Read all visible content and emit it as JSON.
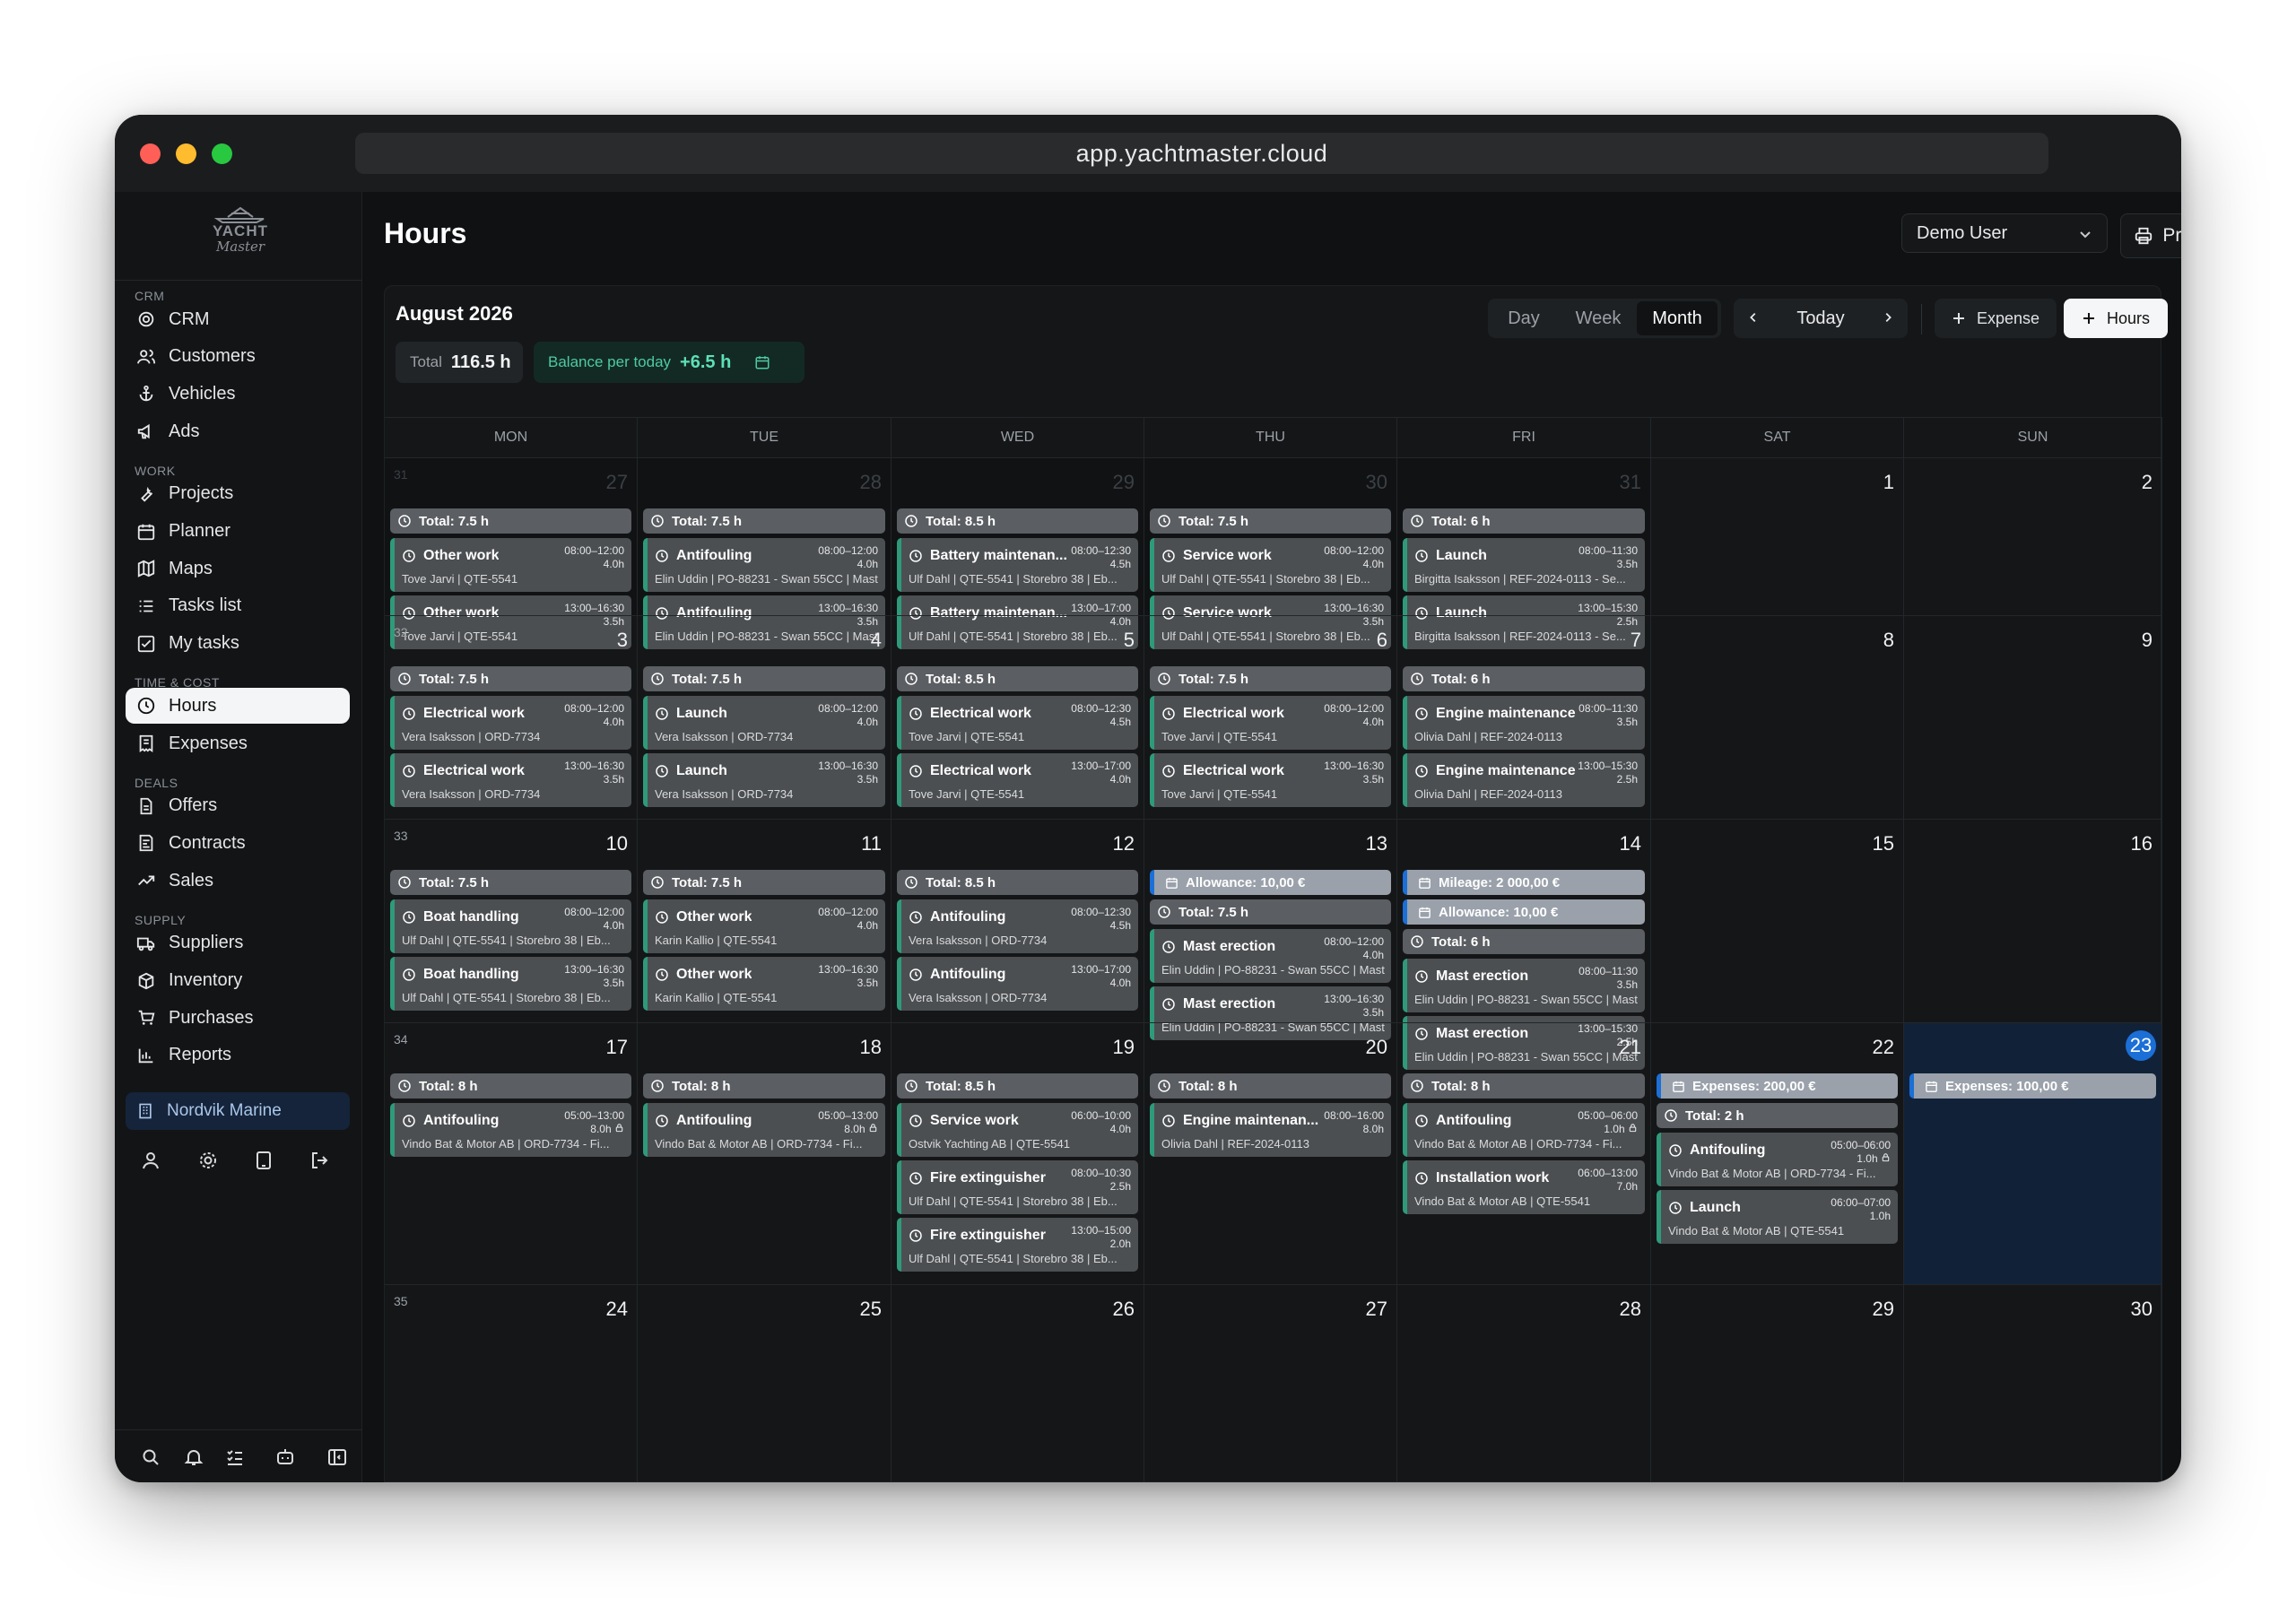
{
  "browser": {
    "url": "app.yachtmaster.cloud"
  },
  "logo": {
    "line1": "YACHT",
    "line2": "Master"
  },
  "sidebar": {
    "sections": [
      {
        "label": "CRM",
        "items": [
          {
            "label": "CRM",
            "icon": "target-icon"
          },
          {
            "label": "Customers",
            "icon": "users-icon"
          },
          {
            "label": "Vehicles",
            "icon": "anchor-icon"
          },
          {
            "label": "Ads",
            "icon": "megaphone-icon"
          }
        ]
      },
      {
        "label": "WORK",
        "items": [
          {
            "label": "Projects",
            "icon": "wrench-icon"
          },
          {
            "label": "Planner",
            "icon": "calendar-icon"
          },
          {
            "label": "Maps",
            "icon": "map-icon"
          },
          {
            "label": "Tasks list",
            "icon": "list-icon"
          },
          {
            "label": "My tasks",
            "icon": "checkbox-icon"
          }
        ]
      },
      {
        "label": "TIME & COST",
        "items": [
          {
            "label": "Hours",
            "icon": "clock-icon",
            "active": true
          },
          {
            "label": "Expenses",
            "icon": "receipt-icon"
          }
        ]
      },
      {
        "label": "DEALS",
        "items": [
          {
            "label": "Offers",
            "icon": "document-icon"
          },
          {
            "label": "Contracts",
            "icon": "contract-icon"
          },
          {
            "label": "Sales",
            "icon": "trend-icon"
          }
        ]
      },
      {
        "label": "SUPPLY",
        "items": [
          {
            "label": "Suppliers",
            "icon": "truck-icon"
          },
          {
            "label": "Inventory",
            "icon": "box-icon"
          },
          {
            "label": "Purchases",
            "icon": "cart-icon"
          },
          {
            "label": "Reports",
            "icon": "chart-icon"
          }
        ]
      }
    ],
    "company": "Nordvik Marine"
  },
  "header": {
    "title": "Hours",
    "user": "Demo User",
    "print_label": "Print"
  },
  "calendar": {
    "month_label": "August 2026",
    "total_label": "Total",
    "total_value": "116.5 h",
    "balance_label": "Balance per today",
    "balance_value": "+6.5 h",
    "views": [
      "Day",
      "Week",
      "Month"
    ],
    "active_view": "Month",
    "today_label": "Today",
    "expense_label": "Expense",
    "hours_label": "Hours",
    "day_names": [
      "MON",
      "TUE",
      "WED",
      "THU",
      "FRI",
      "SAT",
      "SUN"
    ],
    "weeks": [
      {
        "week": "31",
        "days": [
          {
            "day": "27",
            "outside": true,
            "events": [
              {
                "kind": "total",
                "text": "Total: 7.5 h"
              },
              {
                "kind": "entry",
                "title": "Other work",
                "time": "08:00–12:00",
                "dur": "4.0h",
                "sub": "Tove Jarvi | QTE-5541"
              },
              {
                "kind": "entry",
                "title": "Other work",
                "time": "13:00–16:30",
                "dur": "3.5h",
                "sub": "Tove Jarvi | QTE-5541"
              }
            ]
          },
          {
            "day": "28",
            "outside": true,
            "events": [
              {
                "kind": "total",
                "text": "Total: 7.5 h"
              },
              {
                "kind": "entry",
                "title": "Antifouling",
                "time": "08:00–12:00",
                "dur": "4.0h",
                "sub": "Elin Uddin | PO-88231 - Swan 55CC | Mast"
              },
              {
                "kind": "entry",
                "title": "Antifouling",
                "time": "13:00–16:30",
                "dur": "3.5h",
                "sub": "Elin Uddin | PO-88231 - Swan 55CC | Mast"
              }
            ]
          },
          {
            "day": "29",
            "outside": true,
            "events": [
              {
                "kind": "total",
                "text": "Total: 8.5 h"
              },
              {
                "kind": "entry",
                "title": "Battery maintenan...",
                "time": "08:00–12:30",
                "dur": "4.5h",
                "sub": "Ulf Dahl | QTE-5541 | Storebro 38 | Eb..."
              },
              {
                "kind": "entry",
                "title": "Battery maintenan...",
                "time": "13:00–17:00",
                "dur": "4.0h",
                "sub": "Ulf Dahl | QTE-5541 | Storebro 38 | Eb..."
              }
            ]
          },
          {
            "day": "30",
            "outside": true,
            "events": [
              {
                "kind": "total",
                "text": "Total: 7.5 h"
              },
              {
                "kind": "entry",
                "title": "Service work",
                "time": "08:00–12:00",
                "dur": "4.0h",
                "sub": "Ulf Dahl | QTE-5541 | Storebro 38 | Eb..."
              },
              {
                "kind": "entry",
                "title": "Service work",
                "time": "13:00–16:30",
                "dur": "3.5h",
                "sub": "Ulf Dahl | QTE-5541 | Storebro 38 | Eb..."
              }
            ]
          },
          {
            "day": "31",
            "outside": true,
            "events": [
              {
                "kind": "total",
                "text": "Total: 6 h"
              },
              {
                "kind": "entry",
                "title": "Launch",
                "time": "08:00–11:30",
                "dur": "3.5h",
                "sub": "Birgitta Isaksson | REF-2024-0113 - Se..."
              },
              {
                "kind": "entry",
                "title": "Launch",
                "time": "13:00–15:30",
                "dur": "2.5h",
                "sub": "Birgitta Isaksson | REF-2024-0113 - Se..."
              }
            ]
          },
          {
            "day": "1",
            "events": []
          },
          {
            "day": "2",
            "events": []
          }
        ]
      },
      {
        "week": "32",
        "days": [
          {
            "day": "3",
            "events": [
              {
                "kind": "total",
                "text": "Total: 7.5 h"
              },
              {
                "kind": "entry",
                "title": "Electrical work",
                "time": "08:00–12:00",
                "dur": "4.0h",
                "sub": "Vera Isaksson | ORD-7734"
              },
              {
                "kind": "entry",
                "title": "Electrical work",
                "time": "13:00–16:30",
                "dur": "3.5h",
                "sub": "Vera Isaksson | ORD-7734"
              }
            ]
          },
          {
            "day": "4",
            "events": [
              {
                "kind": "total",
                "text": "Total: 7.5 h"
              },
              {
                "kind": "entry",
                "title": "Launch",
                "time": "08:00–12:00",
                "dur": "4.0h",
                "sub": "Vera Isaksson | ORD-7734"
              },
              {
                "kind": "entry",
                "title": "Launch",
                "time": "13:00–16:30",
                "dur": "3.5h",
                "sub": "Vera Isaksson | ORD-7734"
              }
            ]
          },
          {
            "day": "5",
            "events": [
              {
                "kind": "total",
                "text": "Total: 8.5 h"
              },
              {
                "kind": "entry",
                "title": "Electrical work",
                "time": "08:00–12:30",
                "dur": "4.5h",
                "sub": "Tove Jarvi | QTE-5541"
              },
              {
                "kind": "entry",
                "title": "Electrical work",
                "time": "13:00–17:00",
                "dur": "4.0h",
                "sub": "Tove Jarvi | QTE-5541"
              }
            ]
          },
          {
            "day": "6",
            "events": [
              {
                "kind": "total",
                "text": "Total: 7.5 h"
              },
              {
                "kind": "entry",
                "title": "Electrical work",
                "time": "08:00–12:00",
                "dur": "4.0h",
                "sub": "Tove Jarvi | QTE-5541"
              },
              {
                "kind": "entry",
                "title": "Electrical work",
                "time": "13:00–16:30",
                "dur": "3.5h",
                "sub": "Tove Jarvi | QTE-5541"
              }
            ]
          },
          {
            "day": "7",
            "events": [
              {
                "kind": "total",
                "text": "Total: 6 h"
              },
              {
                "kind": "entry",
                "title": "Engine maintenance",
                "time": "08:00–11:30",
                "dur": "3.5h",
                "sub": "Olivia Dahl | REF-2024-0113"
              },
              {
                "kind": "entry",
                "title": "Engine maintenance",
                "time": "13:00–15:30",
                "dur": "2.5h",
                "sub": "Olivia Dahl | REF-2024-0113"
              }
            ]
          },
          {
            "day": "8",
            "events": []
          },
          {
            "day": "9",
            "events": []
          }
        ]
      },
      {
        "week": "33",
        "days": [
          {
            "day": "10",
            "events": [
              {
                "kind": "total",
                "text": "Total: 7.5 h"
              },
              {
                "kind": "entry",
                "title": "Boat handling",
                "time": "08:00–12:00",
                "dur": "4.0h",
                "sub": "Ulf Dahl | QTE-5541 | Storebro 38 | Eb..."
              },
              {
                "kind": "entry",
                "title": "Boat handling",
                "time": "13:00–16:30",
                "dur": "3.5h",
                "sub": "Ulf Dahl | QTE-5541 | Storebro 38 | Eb..."
              }
            ]
          },
          {
            "day": "11",
            "events": [
              {
                "kind": "total",
                "text": "Total: 7.5 h"
              },
              {
                "kind": "entry",
                "title": "Other work",
                "time": "08:00–12:00",
                "dur": "4.0h",
                "sub": "Karin Kallio | QTE-5541"
              },
              {
                "kind": "entry",
                "title": "Other work",
                "time": "13:00–16:30",
                "dur": "3.5h",
                "sub": "Karin Kallio | QTE-5541"
              }
            ]
          },
          {
            "day": "12",
            "events": [
              {
                "kind": "total",
                "text": "Total: 8.5 h"
              },
              {
                "kind": "entry",
                "title": "Antifouling",
                "time": "08:00–12:30",
                "dur": "4.5h",
                "sub": "Vera Isaksson | ORD-7734"
              },
              {
                "kind": "entry",
                "title": "Antifouling",
                "time": "13:00–17:00",
                "dur": "4.0h",
                "sub": "Vera Isaksson | ORD-7734"
              }
            ]
          },
          {
            "day": "13",
            "events": [
              {
                "kind": "money",
                "text": "Allowance: 10,00 €"
              },
              {
                "kind": "total",
                "text": "Total: 7.5 h"
              },
              {
                "kind": "entry",
                "title": "Mast erection",
                "time": "08:00–12:00",
                "dur": "4.0h",
                "sub": "Elin Uddin | PO-88231 - Swan 55CC | Mast"
              },
              {
                "kind": "entry",
                "title": "Mast erection",
                "time": "13:00–16:30",
                "dur": "3.5h",
                "sub": "Elin Uddin | PO-88231 - Swan 55CC | Mast"
              }
            ]
          },
          {
            "day": "14",
            "events": [
              {
                "kind": "money",
                "text": "Mileage: 2 000,00 €"
              },
              {
                "kind": "money",
                "text": "Allowance: 10,00 €"
              },
              {
                "kind": "total",
                "text": "Total: 6 h"
              },
              {
                "kind": "entry",
                "title": "Mast erection",
                "time": "08:00–11:30",
                "dur": "3.5h",
                "sub": "Elin Uddin | PO-88231 - Swan 55CC | Mast"
              },
              {
                "kind": "entry",
                "title": "Mast erection",
                "time": "13:00–15:30",
                "dur": "2.5h",
                "sub": "Elin Uddin | PO-88231 - Swan 55CC | Mast"
              }
            ]
          },
          {
            "day": "15",
            "events": []
          },
          {
            "day": "16",
            "events": []
          }
        ]
      },
      {
        "week": "34",
        "days": [
          {
            "day": "17",
            "events": [
              {
                "kind": "total",
                "text": "Total: 8 h"
              },
              {
                "kind": "entry",
                "title": "Antifouling",
                "time": "05:00–13:00",
                "dur": "8.0h",
                "lock": true,
                "sub": "Vindo Bat & Motor AB | ORD-7734 - Fi..."
              }
            ]
          },
          {
            "day": "18",
            "events": [
              {
                "kind": "total",
                "text": "Total: 8 h"
              },
              {
                "kind": "entry",
                "title": "Antifouling",
                "time": "05:00–13:00",
                "dur": "8.0h",
                "lock": true,
                "sub": "Vindo Bat & Motor AB | ORD-7734 - Fi..."
              }
            ]
          },
          {
            "day": "19",
            "events": [
              {
                "kind": "total",
                "text": "Total: 8.5 h"
              },
              {
                "kind": "entry",
                "title": "Service work",
                "time": "06:00–10:00",
                "dur": "4.0h",
                "sub": "Ostvik Yachting AB | QTE-5541"
              },
              {
                "kind": "entry",
                "title": "Fire extinguisher",
                "time": "08:00–10:30",
                "dur": "2.5h",
                "sub": "Ulf Dahl | QTE-5541 | Storebro 38 | Eb..."
              },
              {
                "kind": "entry",
                "title": "Fire extinguisher",
                "time": "13:00–15:00",
                "dur": "2.0h",
                "sub": "Ulf Dahl | QTE-5541 | Storebro 38 | Eb..."
              }
            ]
          },
          {
            "day": "20",
            "events": [
              {
                "kind": "total",
                "text": "Total: 8 h"
              },
              {
                "kind": "entry",
                "title": "Engine maintenan...",
                "time": "08:00–16:00",
                "dur": "8.0h",
                "sub": "Olivia Dahl | REF-2024-0113"
              }
            ]
          },
          {
            "day": "21",
            "events": [
              {
                "kind": "total",
                "text": "Total: 8 h"
              },
              {
                "kind": "entry",
                "title": "Antifouling",
                "time": "05:00–06:00",
                "dur": "1.0h",
                "lock": true,
                "sub": "Vindo Bat & Motor AB | ORD-7734 - Fi..."
              },
              {
                "kind": "entry",
                "title": "Installation work",
                "time": "06:00–13:00",
                "dur": "7.0h",
                "sub": "Vindo Bat & Motor AB | QTE-5541"
              }
            ]
          },
          {
            "day": "22",
            "events": [
              {
                "kind": "money",
                "text": "Expenses: 200,00 €"
              },
              {
                "kind": "total",
                "text": "Total: 2 h"
              },
              {
                "kind": "entry",
                "title": "Antifouling",
                "time": "05:00–06:00",
                "dur": "1.0h",
                "lock": true,
                "sub": "Vindo Bat & Motor AB | ORD-7734 - Fi..."
              },
              {
                "kind": "entry",
                "title": "Launch",
                "time": "06:00–07:00",
                "dur": "1.0h",
                "sub": "Vindo Bat & Motor AB | QTE-5541"
              }
            ]
          },
          {
            "day": "23",
            "today": true,
            "events": [
              {
                "kind": "money",
                "text": "Expenses: 100,00 €"
              }
            ]
          }
        ]
      },
      {
        "week": "35",
        "days": [
          {
            "day": "24",
            "events": []
          },
          {
            "day": "25",
            "events": []
          },
          {
            "day": "26",
            "events": []
          },
          {
            "day": "27",
            "events": []
          },
          {
            "day": "28",
            "events": []
          },
          {
            "day": "29",
            "events": []
          },
          {
            "day": "30",
            "events": []
          }
        ]
      }
    ]
  }
}
